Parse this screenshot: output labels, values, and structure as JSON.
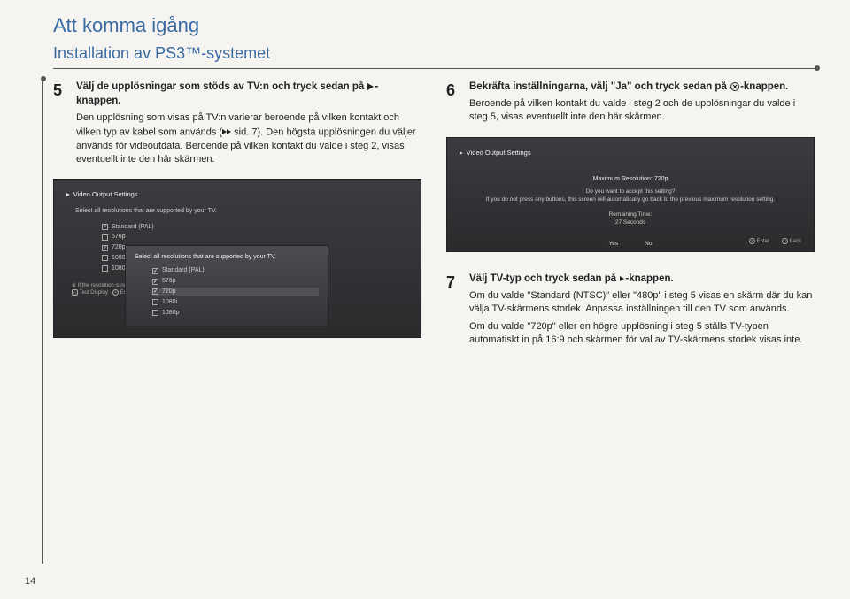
{
  "header": {
    "title": "Att komma igång",
    "subtitle": "Installation av PS3™-systemet"
  },
  "step5": {
    "num": "5",
    "title_a": "Välj de upplösningar som stöds av TV:n och tryck sedan på",
    "title_b": "-knappen.",
    "p1a": "Den upplösning som visas på TV:n varierar beroende på vilken kontakt och vilken typ av kabel som används (",
    "p1b": " sid. 7). Den högsta upplösningen du väljer används för videoutdata. Beroende på vilken kontakt du valde i steg 2, visas eventuellt inte den här skärmen."
  },
  "step6": {
    "num": "6",
    "title_a": "Bekräfta inställningarna, välj \"Ja\" och tryck sedan på",
    "title_b": "-knappen.",
    "p1": "Beroende på vilken kontakt du valde i steg 2 och de upplösningar du valde i steg 5, visas eventuellt inte den här skärmen."
  },
  "step7": {
    "num": "7",
    "title_a": "Välj TV-typ och tryck sedan på",
    "title_b": "-knappen.",
    "p1": "Om du valde \"Standard (NTSC)\" eller \"480p\" i steg 5 visas en skärm där du kan välja TV-skärmens storlek. Anpassa inställningen till den TV som används.",
    "p2": "Om du valde \"720p\" eller en högre upplösning i steg 5 ställs TV-typen automatiskt in på 16:9 och skärmen för val av TV-skärmens storlek visas inte."
  },
  "ss1": {
    "title": "Video Output Settings",
    "subtitle": "Select all resolutions that are supported by your TV.",
    "res": [
      "Standard (PAL)",
      "576p",
      "720p",
      "1080i",
      "1080p"
    ],
    "note": "If the resolution is not correct, the screen will",
    "test": "Test Display",
    "enter": "Enter",
    "overlay_sub": "Select all resolutions that are supported by your TV.",
    "overlay_res": [
      "Standard (PAL)",
      "576p",
      "720p",
      "1080i",
      "1080p"
    ]
  },
  "ss2": {
    "title": "Video Output Settings",
    "max": "Maximum Resolution: 720p",
    "q1": "Do you want to accept this setting?",
    "q2": "If you do not press any buttons, this screen will automatically go back to the previous maximum resolution setting.",
    "remain1": "Remaining Time:",
    "remain2": "27 Seconds",
    "yes": "Yes",
    "no": "No",
    "enter": "Enter",
    "back": "Back"
  },
  "page_number": "14"
}
